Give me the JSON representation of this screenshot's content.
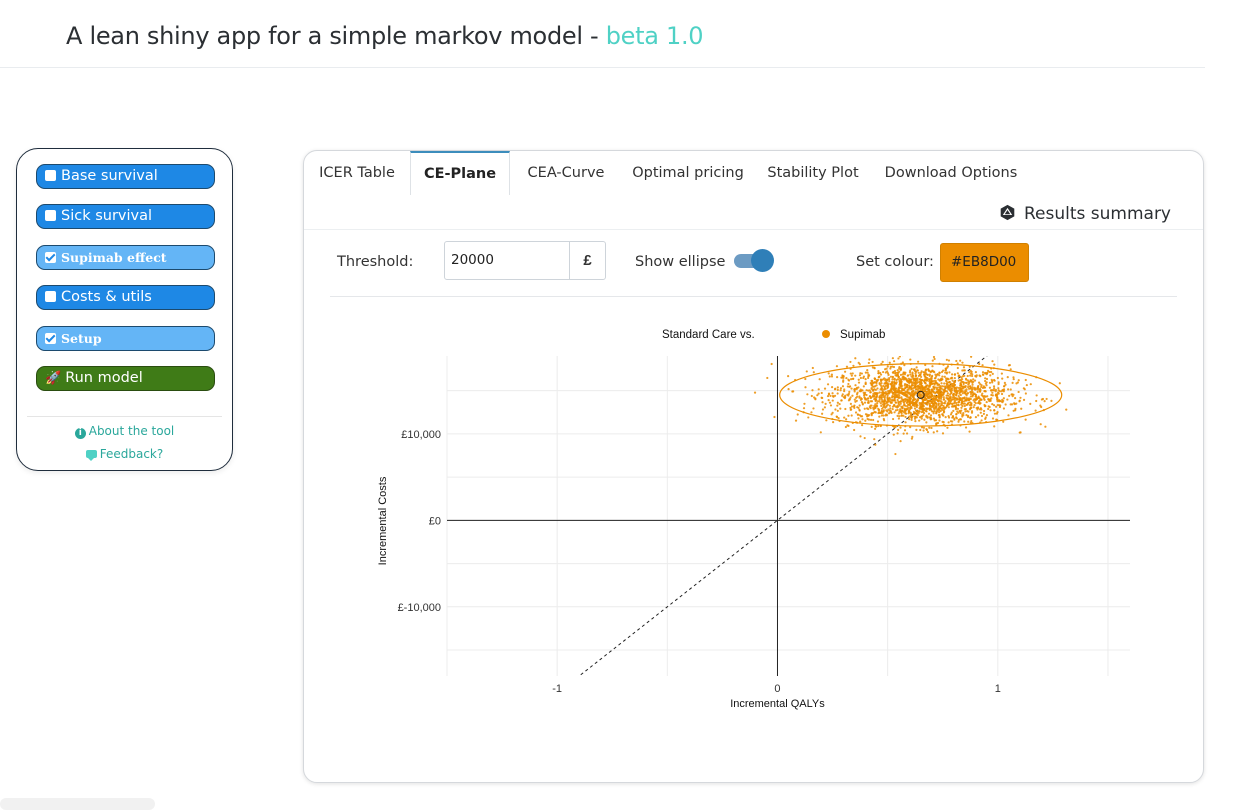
{
  "header": {
    "title": "A lean shiny app for a simple markov model - ",
    "beta": "beta 1.0"
  },
  "sidebar": {
    "buttons": [
      {
        "label": "Base survival",
        "checked": false
      },
      {
        "label": "Sick survival",
        "checked": false
      },
      {
        "label": "Supimab effect",
        "checked": true
      },
      {
        "label": "Costs & utils",
        "checked": false
      },
      {
        "label": "Setup",
        "checked": true
      }
    ],
    "run_label": "Run model",
    "about_label": "About the tool",
    "feedback_label": "Feedback?"
  },
  "tabs": [
    "ICER Table",
    "CE-Plane",
    "CEA-Curve",
    "Optimal pricing",
    "Stability Plot",
    "Download Options"
  ],
  "active_tab": "CE-Plane",
  "results_summary": "Results summary",
  "controls": {
    "threshold_label": "Threshold:",
    "threshold_value": "20000",
    "currency": "£",
    "show_ellipse_label": "Show ellipse",
    "show_ellipse": true,
    "colour_label": "Set colour:",
    "colour_value": "#EB8D00"
  },
  "colors": {
    "accent": "#EB8D00",
    "tab_accent": "#3c8dbc",
    "button_blue": "#1e88e5",
    "button_green": "#3f7b17",
    "teal": "#4fd1c5"
  },
  "chart_data": {
    "type": "scatter",
    "legend": {
      "prefix": "Standard Care vs.",
      "series": "Supimab",
      "placement": "top-center"
    },
    "xlabel": "Incremental QALYs",
    "ylabel": "Incremental Costs",
    "xlim": [
      -1.5,
      1.6
    ],
    "ylim": [
      -18000,
      19000
    ],
    "x_ticks": [
      {
        "v": -1,
        "label": "-1"
      },
      {
        "v": 0,
        "label": "0"
      },
      {
        "v": 1,
        "label": "1"
      }
    ],
    "y_ticks": [
      {
        "v": 10000,
        "label": "£10,000"
      },
      {
        "v": 0,
        "label": "£0"
      },
      {
        "v": -10000,
        "label": "£-10,000"
      }
    ],
    "point_cloud": {
      "n": 2200,
      "x_mean": 0.65,
      "x_sd": 0.2,
      "y_mean": 14500,
      "y_sd": 1700
    },
    "mean_point": {
      "x": 0.65,
      "y": 14500
    },
    "ellipse": {
      "cx": 0.65,
      "cy": 14500,
      "rx": 0.64,
      "ry": 3600
    },
    "threshold_line_slope": 20000,
    "grid": true
  }
}
